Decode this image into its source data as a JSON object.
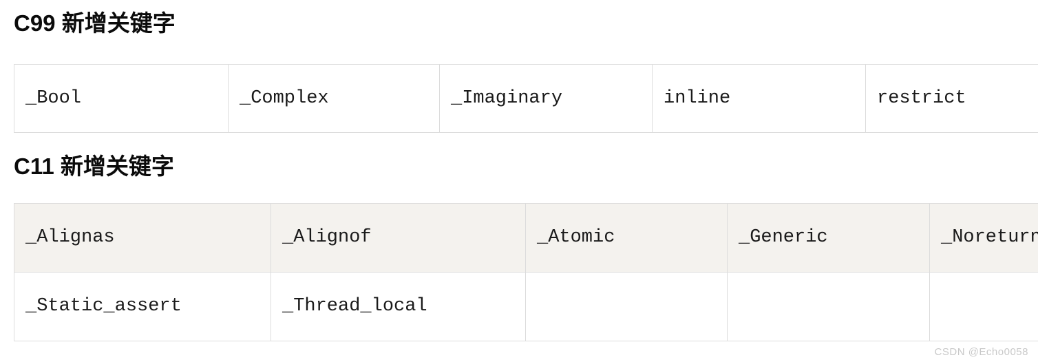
{
  "sections": [
    {
      "heading": "C99 新增关键字",
      "table": {
        "rows": [
          {
            "shaded": false,
            "cells": [
              "_Bool",
              "_Complex",
              "_Imaginary",
              "inline",
              "restrict"
            ]
          }
        ]
      }
    },
    {
      "heading": "C11 新增关键字",
      "table": {
        "rows": [
          {
            "shaded": true,
            "cells": [
              "_Alignas",
              "_Alignof",
              "_Atomic",
              "_Generic",
              "_Noreturn"
            ]
          },
          {
            "shaded": false,
            "cells": [
              "_Static_assert",
              "_Thread_local",
              "",
              "",
              ""
            ]
          }
        ]
      }
    }
  ],
  "watermark": {
    "text": "CSDN @Echo0058"
  },
  "colors": {
    "heading_text": "#0b0b0b",
    "cell_text": "#1a1a1a",
    "border": "#dcdcdc",
    "shaded_row_background": "#f4f2ee",
    "plain_row_background": "#ffffff",
    "watermark_text": "#c9c9c9",
    "page_background": "#ffffff"
  }
}
